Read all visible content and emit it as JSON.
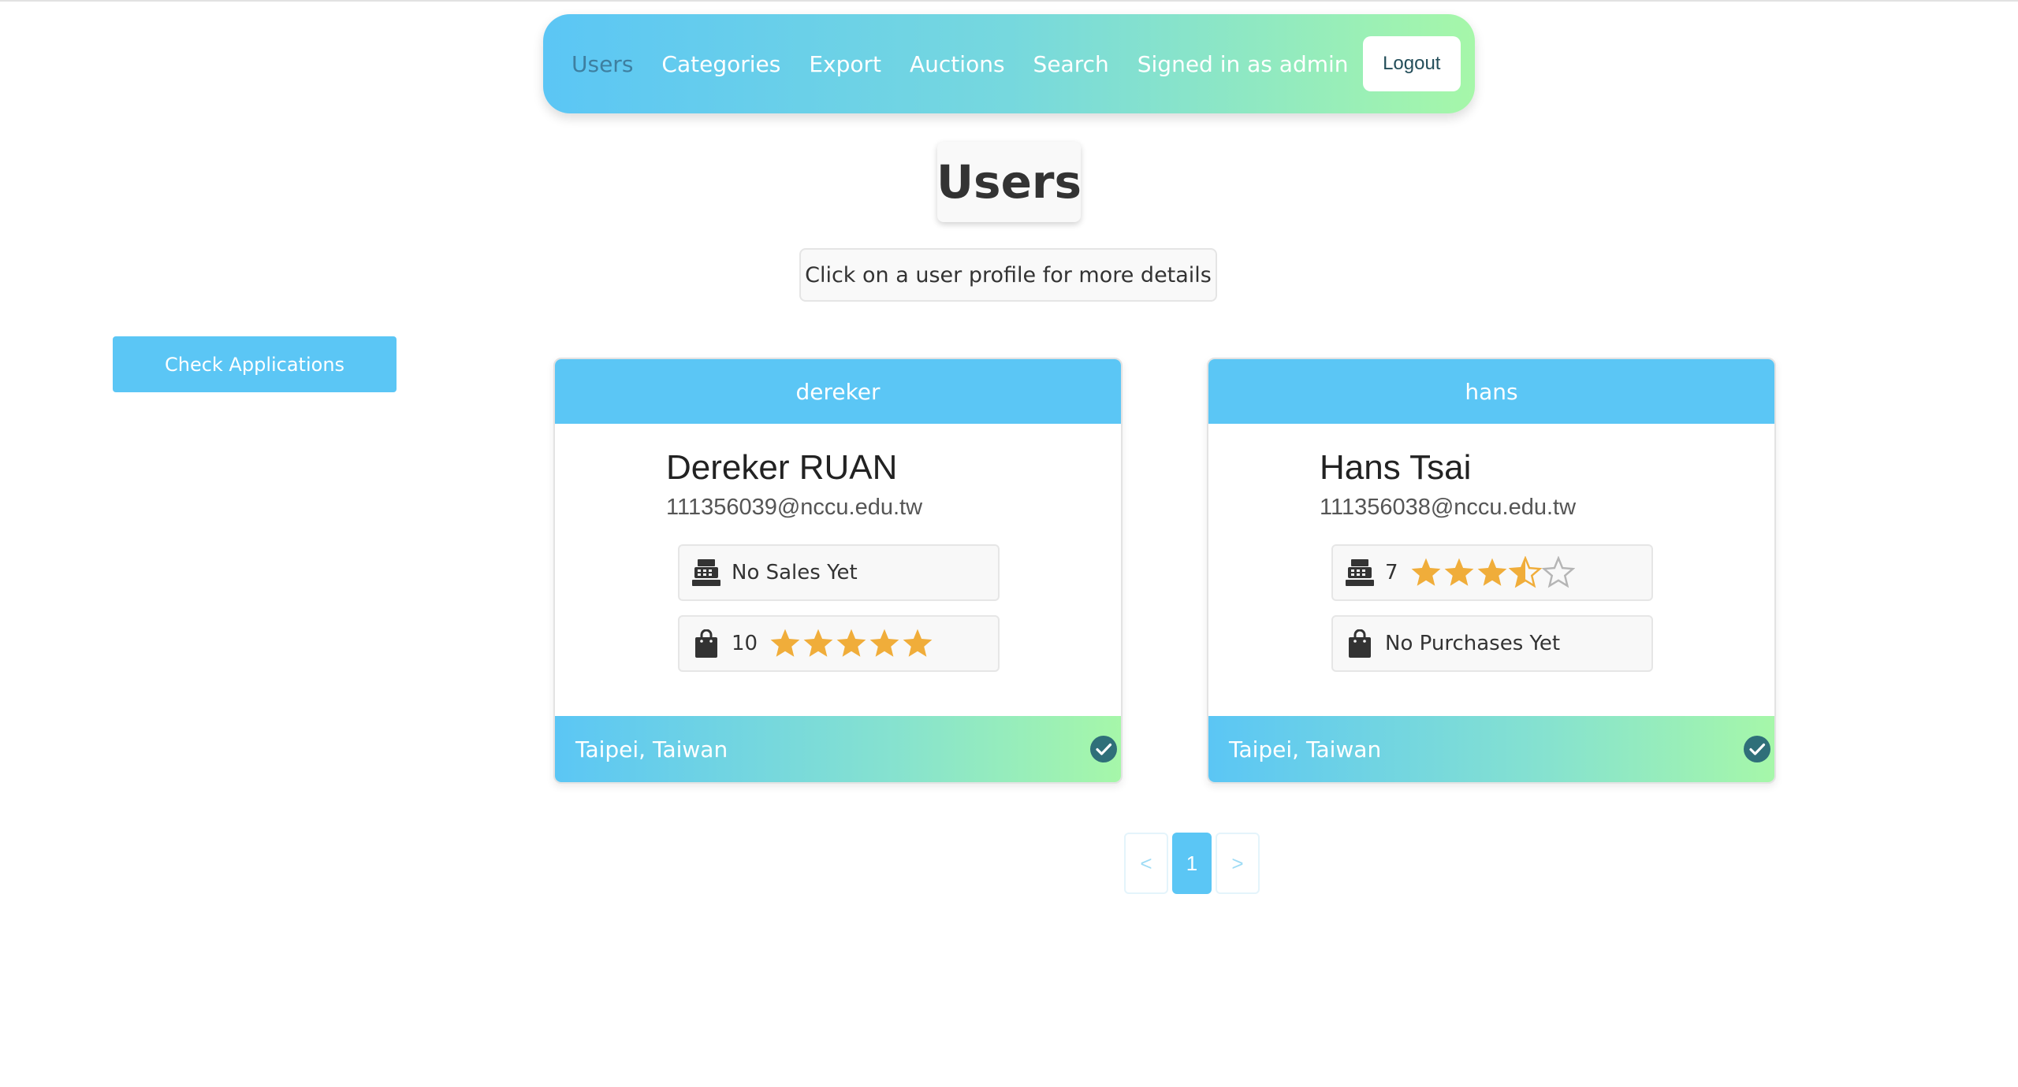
{
  "nav": {
    "links": [
      "Users",
      "Categories",
      "Export",
      "Auctions",
      "Search"
    ],
    "signed_in": "Signed in as admin",
    "logout": "Logout"
  },
  "page": {
    "title": "Users",
    "subtitle": "Click on a user profile for more details",
    "check_button": "Check Applications"
  },
  "users": [
    {
      "username": "dereker",
      "full_name": "Dereker RUAN",
      "email": "111356039@nccu.edu.tw",
      "sales_text": "No Sales Yet",
      "sales_rating": null,
      "purchases_text": "10",
      "purchases_rating": 5,
      "location": "Taipei, Taiwan",
      "verified": true
    },
    {
      "username": "hans",
      "full_name": "Hans Tsai",
      "email": "111356038@nccu.edu.tw",
      "sales_text": "7",
      "sales_rating": 3.5,
      "purchases_text": "No Purchases Yet",
      "purchases_rating": null,
      "location": "Taipei, Taiwan",
      "verified": true
    }
  ],
  "pagination": {
    "prev": "<",
    "current": "1",
    "next": ">"
  },
  "colors": {
    "primary": "#5bc6f5",
    "gradient_end": "#a6f7a9",
    "star": "#f0ad3a",
    "verified": "#2f6f79"
  }
}
